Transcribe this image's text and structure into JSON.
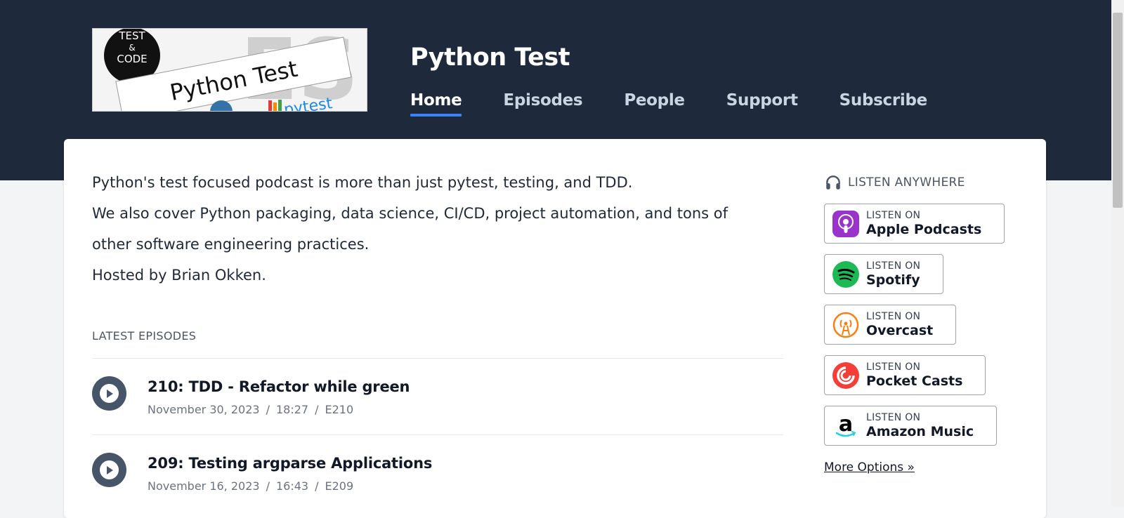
{
  "site": {
    "title": "Python Test",
    "logo_text": {
      "badge_line1": "TEST",
      "badge_line2": "&",
      "badge_line3": "CODE",
      "banner": "Python Test",
      "corner": "pytest"
    }
  },
  "nav": {
    "items": [
      {
        "label": "Home",
        "active": true
      },
      {
        "label": "Episodes",
        "active": false
      },
      {
        "label": "People",
        "active": false
      },
      {
        "label": "Support",
        "active": false
      },
      {
        "label": "Subscribe",
        "active": false
      }
    ]
  },
  "intro": {
    "line1": "Python's test focused podcast is more than just pytest, testing, and TDD.",
    "line2": "We also cover Python packaging, data science, CI/CD, project automation, and tons of other software engineering practices.",
    "line3": "Hosted by Brian Okken."
  },
  "latest": {
    "heading": "LATEST EPISODES",
    "episodes": [
      {
        "title": "210: TDD - Refactor while green",
        "date": "November 30, 2023",
        "duration": "18:27",
        "code": "E210"
      },
      {
        "title": "209: Testing argparse Applications",
        "date": "November 16, 2023",
        "duration": "16:43",
        "code": "E209"
      }
    ],
    "separator": "/"
  },
  "listen": {
    "heading": "LISTEN ANYWHERE",
    "prefix": "LISTEN ON",
    "platforms": [
      {
        "name": "Apple Podcasts",
        "icon": "apple-podcasts-icon",
        "color": "#9933cc"
      },
      {
        "name": "Spotify",
        "icon": "spotify-icon",
        "color": "#1db954"
      },
      {
        "name": "Overcast",
        "icon": "overcast-icon",
        "color": "#fc7e0f"
      },
      {
        "name": "Pocket Casts",
        "icon": "pocket-casts-icon",
        "color": "#f43e37"
      },
      {
        "name": "Amazon Music",
        "icon": "amazon-music-icon",
        "color": "#000000"
      }
    ],
    "more": "More Options »"
  },
  "colors": {
    "header_bg": "#1e293b",
    "accent": "#3b82f6",
    "play_bg": "#475569"
  }
}
